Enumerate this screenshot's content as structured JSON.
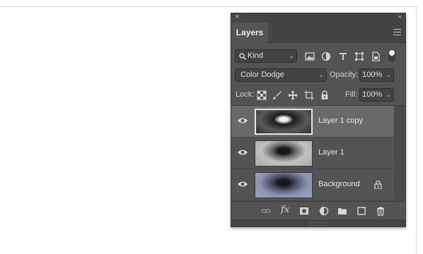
{
  "panel": {
    "tab_label": "Layers",
    "filter": {
      "kind_label": "Kind"
    },
    "blend_mode": "Color Dodge",
    "opacity_label": "Opacity:",
    "opacity_value": "100%",
    "lock_label": "Lock:",
    "fill_label": "Fill:",
    "fill_value": "100%",
    "layers": [
      {
        "name": "Layer 1 copy",
        "selected": true,
        "visible": true,
        "locked": false
      },
      {
        "name": "Layer 1",
        "selected": false,
        "visible": true,
        "locked": false
      },
      {
        "name": "Background",
        "selected": false,
        "visible": true,
        "locked": true
      }
    ],
    "bottom_icons": [
      "link-layers-icon",
      "fx-icon",
      "add-mask-icon",
      "adjustment-layer-icon",
      "new-group-icon",
      "new-layer-icon",
      "delete-layer-icon"
    ],
    "fx_label": "fx"
  },
  "colors": {
    "panel_bg": "#535353",
    "selected_row": "#696969",
    "field_bg": "#434343"
  }
}
